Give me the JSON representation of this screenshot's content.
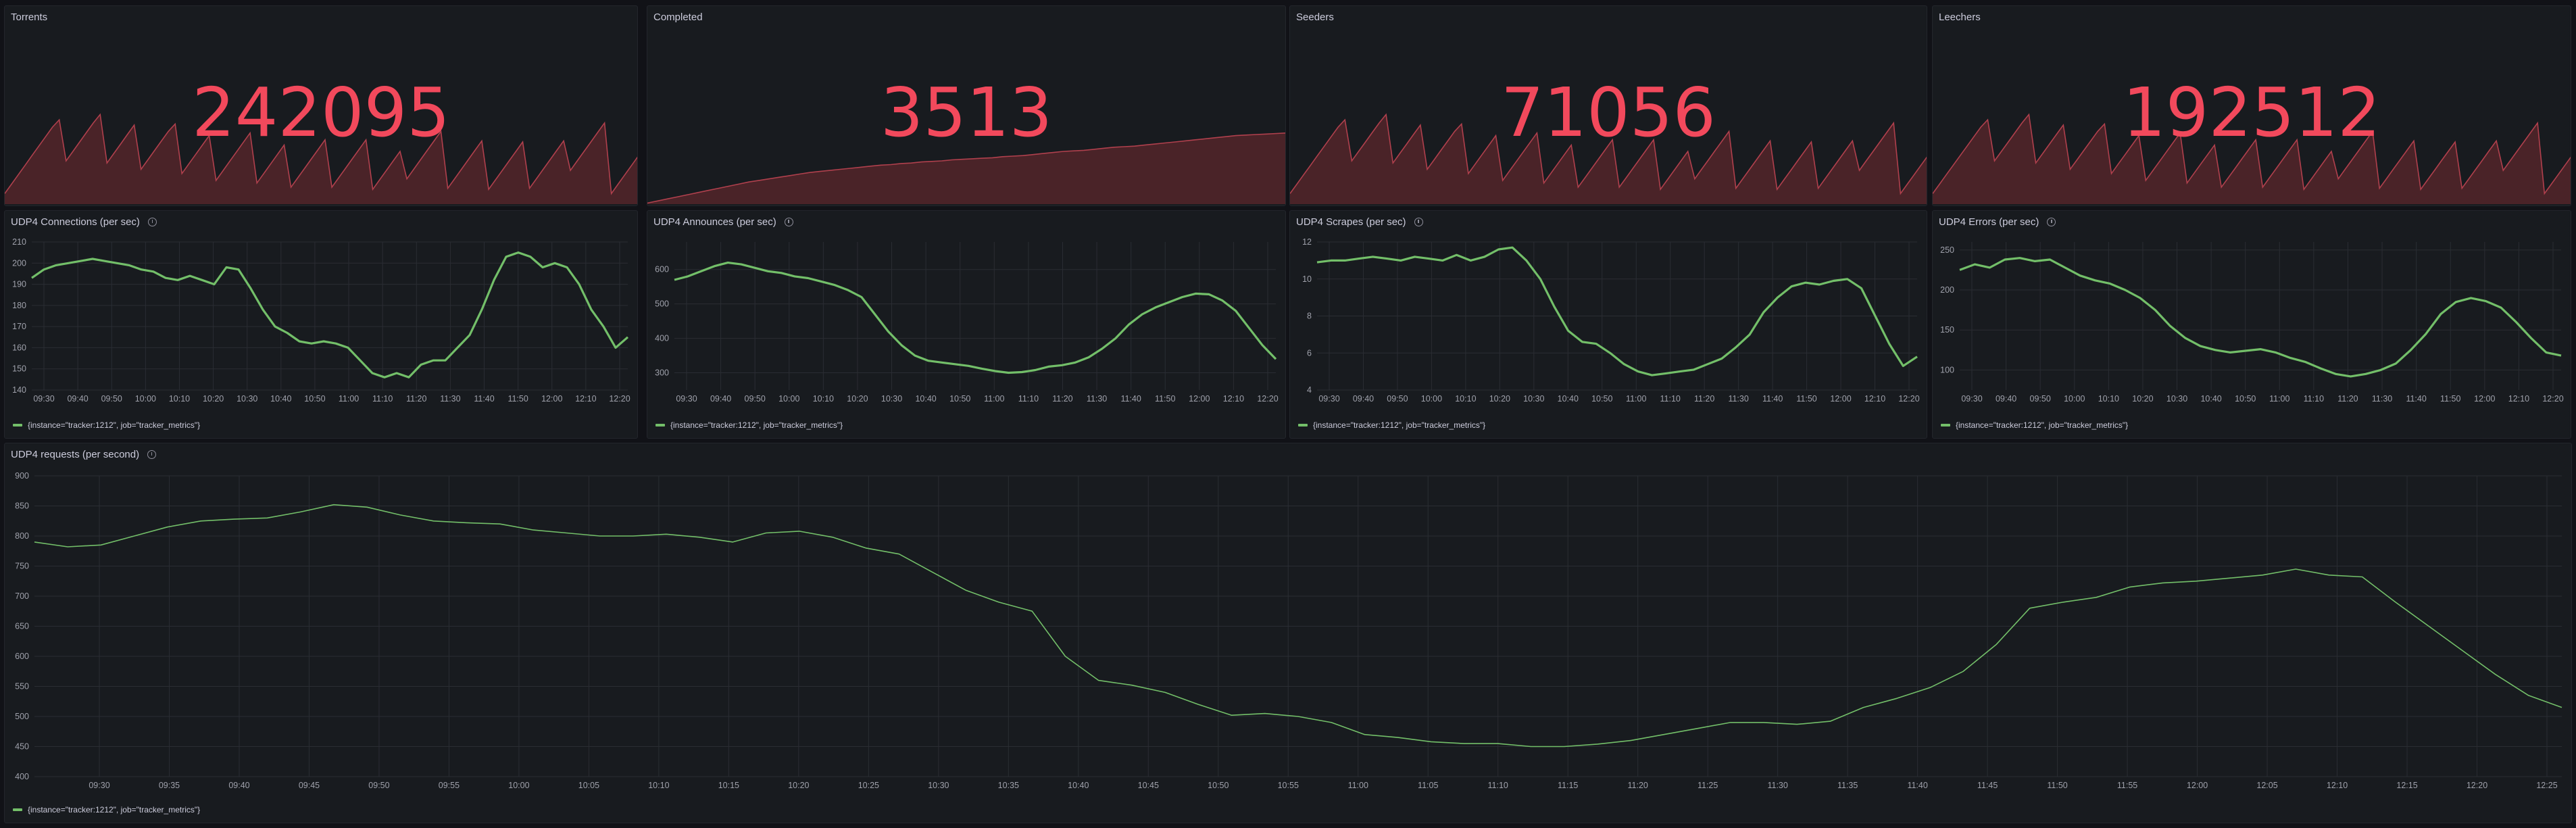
{
  "stats": [
    {
      "title": "Torrents",
      "value": "242095",
      "series": [
        20,
        38,
        56,
        74,
        92,
        110,
        128,
        146,
        160,
        82,
        100,
        118,
        136,
        154,
        170,
        78,
        96,
        114,
        132,
        150,
        66,
        84,
        102,
        120,
        138,
        152,
        58,
        76,
        94,
        112,
        130,
        45,
        63,
        81,
        99,
        117,
        135,
        40,
        58,
        76,
        94,
        112,
        32,
        50,
        68,
        86,
        104,
        122,
        32,
        50,
        68,
        86,
        104,
        122,
        28,
        46,
        64,
        82,
        100,
        48,
        66,
        84,
        102,
        120,
        138,
        30,
        48,
        66,
        84,
        102,
        120,
        28,
        46,
        64,
        82,
        100,
        118,
        30,
        48,
        66,
        84,
        102,
        120,
        64,
        82,
        100,
        118,
        136,
        154,
        20,
        38,
        56,
        74,
        92
      ]
    },
    {
      "title": "Completed",
      "value": "3513",
      "series": [
        2,
        6,
        10,
        14,
        18,
        22,
        26,
        30,
        34,
        38,
        42,
        45,
        48,
        51,
        54,
        57,
        60,
        62,
        64,
        66,
        68,
        70,
        72,
        74,
        75,
        77,
        78,
        80,
        81,
        82,
        84,
        85,
        86,
        87,
        88,
        90,
        91,
        92,
        94,
        96,
        98,
        100,
        101,
        102,
        104,
        106,
        108,
        109,
        110,
        112,
        114,
        116,
        118,
        120,
        122,
        124,
        126,
        128,
        130,
        131,
        132,
        133,
        134,
        135
      ]
    },
    {
      "title": "Seeders",
      "value": "71056",
      "series": [
        20,
        38,
        56,
        74,
        92,
        110,
        128,
        146,
        160,
        82,
        100,
        118,
        136,
        154,
        170,
        78,
        96,
        114,
        132,
        150,
        66,
        84,
        102,
        120,
        138,
        152,
        58,
        76,
        94,
        112,
        130,
        45,
        63,
        81,
        99,
        117,
        135,
        40,
        58,
        76,
        94,
        112,
        32,
        50,
        68,
        86,
        104,
        122,
        32,
        50,
        68,
        86,
        104,
        122,
        28,
        46,
        64,
        82,
        100,
        48,
        66,
        84,
        102,
        120,
        138,
        30,
        48,
        66,
        84,
        102,
        120,
        28,
        46,
        64,
        82,
        100,
        118,
        30,
        48,
        66,
        84,
        102,
        120,
        64,
        82,
        100,
        118,
        136,
        154,
        20,
        38,
        56,
        74,
        92
      ]
    },
    {
      "title": "Leechers",
      "value": "192512",
      "series": [
        20,
        38,
        56,
        74,
        92,
        110,
        128,
        146,
        160,
        82,
        100,
        118,
        136,
        154,
        170,
        78,
        96,
        114,
        132,
        150,
        66,
        84,
        102,
        120,
        138,
        152,
        58,
        76,
        94,
        112,
        130,
        45,
        63,
        81,
        99,
        117,
        135,
        40,
        58,
        76,
        94,
        112,
        32,
        50,
        68,
        86,
        104,
        122,
        32,
        50,
        68,
        86,
        104,
        122,
        28,
        46,
        64,
        82,
        100,
        48,
        66,
        84,
        102,
        120,
        138,
        30,
        48,
        66,
        84,
        102,
        120,
        28,
        46,
        64,
        82,
        100,
        118,
        30,
        48,
        66,
        84,
        102,
        120,
        64,
        82,
        100,
        118,
        136,
        154,
        20,
        38,
        56,
        74,
        92
      ]
    }
  ],
  "charts": [
    {
      "title": "UDP4 Connections (per sec)",
      "legend": "{instance=\"tracker:1212\", job=\"tracker_metrics\"}",
      "ylim": [
        140,
        210
      ],
      "yticks": [
        140,
        150,
        160,
        170,
        180,
        190,
        200,
        210
      ],
      "xticks": [
        "09:30",
        "09:40",
        "09:50",
        "10:00",
        "10:10",
        "10:20",
        "10:30",
        "10:40",
        "10:50",
        "11:00",
        "11:10",
        "11:20",
        "11:30",
        "11:40",
        "11:50",
        "12:00",
        "12:10",
        "12:20"
      ],
      "values": [
        193,
        197,
        199,
        200,
        201,
        202,
        201,
        200,
        199,
        197,
        196,
        193,
        192,
        194,
        192,
        190,
        198,
        197,
        188,
        178,
        170,
        167,
        163,
        162,
        163,
        162,
        160,
        154,
        148,
        146,
        148,
        146,
        152,
        154,
        154,
        160,
        166,
        178,
        192,
        203,
        205,
        203,
        198,
        200,
        198,
        190,
        178,
        170,
        160,
        165
      ]
    },
    {
      "title": "UDP4 Announces (per sec)",
      "legend": "{instance=\"tracker:1212\", job=\"tracker_metrics\"}",
      "ylim": [
        250,
        680
      ],
      "yticks": [
        300,
        400,
        500,
        600
      ],
      "xticks": [
        "09:30",
        "09:40",
        "09:50",
        "10:00",
        "10:10",
        "10:20",
        "10:30",
        "10:40",
        "10:50",
        "11:00",
        "11:10",
        "11:20",
        "11:30",
        "11:40",
        "11:50",
        "12:00",
        "12:10",
        "12:20"
      ],
      "values": [
        570,
        580,
        595,
        610,
        620,
        615,
        605,
        595,
        590,
        580,
        575,
        565,
        555,
        540,
        520,
        470,
        420,
        380,
        350,
        335,
        330,
        325,
        320,
        312,
        305,
        300,
        302,
        308,
        318,
        322,
        330,
        345,
        370,
        400,
        440,
        470,
        490,
        505,
        520,
        530,
        528,
        510,
        480,
        430,
        380,
        340
      ]
    },
    {
      "title": "UDP4 Scrapes (per sec)",
      "legend": "{instance=\"tracker:1212\", job=\"tracker_metrics\"}",
      "ylim": [
        4,
        12
      ],
      "yticks": [
        4,
        6,
        8,
        10,
        12
      ],
      "xticks": [
        "09:30",
        "09:40",
        "09:50",
        "10:00",
        "10:10",
        "10:20",
        "10:30",
        "10:40",
        "10:50",
        "11:00",
        "11:10",
        "11:20",
        "11:30",
        "11:40",
        "11:50",
        "12:00",
        "12:10",
        "12:20"
      ],
      "values": [
        10.9,
        11.0,
        11.0,
        11.1,
        11.2,
        11.1,
        11.0,
        11.2,
        11.1,
        11.0,
        11.3,
        11.0,
        11.2,
        11.6,
        11.7,
        11.0,
        10.0,
        8.5,
        7.2,
        6.6,
        6.5,
        6.0,
        5.4,
        5.0,
        4.8,
        4.9,
        5.0,
        5.1,
        5.4,
        5.7,
        6.3,
        7.0,
        8.2,
        9.0,
        9.6,
        9.8,
        9.7,
        9.9,
        10.0,
        9.5,
        8.0,
        6.5,
        5.3,
        5.8
      ]
    },
    {
      "title": "UDP4 Errors (per sec)",
      "legend": "{instance=\"tracker:1212\", job=\"tracker_metrics\"}",
      "ylim": [
        75,
        260
      ],
      "yticks": [
        100,
        150,
        200,
        250
      ],
      "xticks": [
        "09:30",
        "09:40",
        "09:50",
        "10:00",
        "10:10",
        "10:20",
        "10:30",
        "10:40",
        "10:50",
        "11:00",
        "11:10",
        "11:20",
        "11:30",
        "11:40",
        "11:50",
        "12:00",
        "12:10",
        "12:20"
      ],
      "values": [
        225,
        232,
        228,
        238,
        240,
        236,
        238,
        228,
        218,
        212,
        208,
        200,
        190,
        175,
        155,
        140,
        130,
        125,
        122,
        124,
        126,
        122,
        115,
        110,
        102,
        95,
        92,
        95,
        100,
        108,
        125,
        145,
        170,
        185,
        190,
        186,
        178,
        160,
        140,
        122,
        118
      ]
    }
  ],
  "wide_chart": {
    "title": "UDP4 requests (per second)",
    "legend": "{instance=\"tracker:1212\", job=\"tracker_metrics\"}",
    "ylim": [
      400,
      900
    ],
    "yticks": [
      400,
      450,
      500,
      550,
      600,
      650,
      700,
      750,
      800,
      850,
      900
    ],
    "xticks": [
      "09:30",
      "09:35",
      "09:40",
      "09:45",
      "09:50",
      "09:55",
      "10:00",
      "10:05",
      "10:10",
      "10:15",
      "10:20",
      "10:25",
      "10:30",
      "10:35",
      "10:40",
      "10:45",
      "10:50",
      "10:55",
      "11:00",
      "11:05",
      "11:10",
      "11:15",
      "11:20",
      "11:25",
      "11:30",
      "11:35",
      "11:40",
      "11:45",
      "11:50",
      "11:55",
      "12:00",
      "12:05",
      "12:10",
      "12:15",
      "12:20",
      "12:25"
    ],
    "values": [
      790,
      782,
      785,
      800,
      815,
      825,
      828,
      830,
      840,
      852,
      848,
      835,
      825,
      822,
      820,
      810,
      805,
      800,
      800,
      803,
      798,
      790,
      805,
      808,
      798,
      780,
      770,
      740,
      710,
      690,
      675,
      600,
      560,
      552,
      540,
      520,
      502,
      505,
      500,
      490,
      470,
      465,
      458,
      455,
      455,
      450,
      450,
      454,
      460,
      470,
      480,
      490,
      490,
      487,
      492,
      515,
      530,
      548,
      575,
      620,
      680,
      690,
      698,
      715,
      722,
      725,
      730,
      735,
      745,
      735,
      732,
      690,
      650,
      610,
      570,
      535,
      515
    ]
  }
}
